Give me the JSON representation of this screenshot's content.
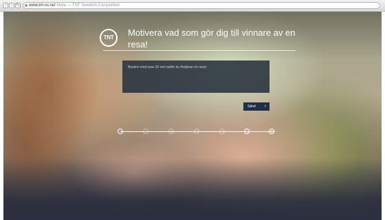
{
  "browser": {
    "url": "www.tnt-vs.se/",
    "tab_title": "Meta — TNT Swedish Competition",
    "back": "‹",
    "forward": "›",
    "reload": "↻"
  },
  "logo": {
    "text": "TNT"
  },
  "form": {
    "headline": "Motivera vad som gör dig till vinnare av en resa!",
    "placeholder": "Beskriv med max 30 ord varför du förtjänar en resa!",
    "send_label": "Sänd",
    "send_icon": "chevron-right-icon"
  },
  "progress": {
    "steps": 7,
    "current_step": 7,
    "completed_fraction": 1.0
  },
  "colors": {
    "panel": "#28323e",
    "button": "#1f3046",
    "text": "#ffffff"
  }
}
